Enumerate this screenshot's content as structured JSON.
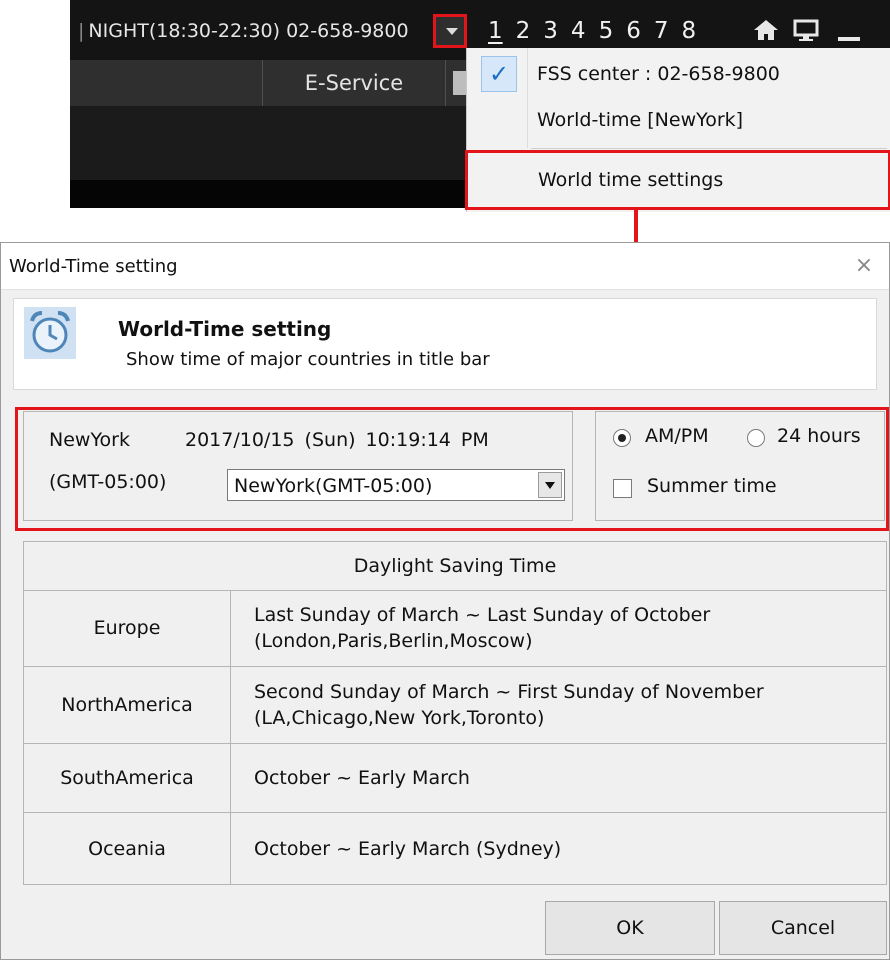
{
  "topbar": {
    "separator": "|",
    "night_info": "NIGHT(18:30-22:30) 02-658-9800",
    "screen_numbers": [
      "1",
      "2",
      "3",
      "4",
      "5",
      "6",
      "7",
      "8"
    ],
    "menu_eservice": "E-Service"
  },
  "context_menu": {
    "items": [
      {
        "label": "FSS center : 02-658-9800",
        "checked": true
      },
      {
        "label": "World-time [NewYork]",
        "checked": false
      },
      {
        "label": "World time settings",
        "checked": false
      }
    ],
    "check_mark": "✓"
  },
  "dialog": {
    "title": "World-Time setting",
    "close_glyph": "×",
    "header_title": "World-Time setting",
    "header_subtitle": "Show time of major countries in title bar",
    "city": "NewYork",
    "datetime": "2017/10/15 (Sun)  10:19:14 PM",
    "gmt": "(GMT-05:00)",
    "timezone_selected": "NewYork(GMT-05:00)",
    "format_ampm": "AM/PM",
    "format_24": "24 hours",
    "summer_time": "Summer time",
    "dst_header": "Daylight Saving Time",
    "dst_rows": [
      {
        "region": "Europe",
        "rule": "Last Sunday of March ~ Last Sunday of October",
        "cities": "(London,Paris,Berlin,Moscow)"
      },
      {
        "region": "NorthAmerica",
        "rule": "Second Sunday of March ~ First Sunday of November",
        "cities": "(LA,Chicago,New York,Toronto)"
      },
      {
        "region": "SouthAmerica",
        "rule": "October ~ Early March",
        "cities": ""
      },
      {
        "region": "Oceania",
        "rule": "October ~ Early March (Sydney)",
        "cities": ""
      }
    ],
    "ok_label": "OK",
    "cancel_label": "Cancel"
  },
  "colors": {
    "highlight_red": "#e3151a",
    "topbar_dark": "#1d1d1d",
    "dialog_bg": "#f0f0f0"
  }
}
